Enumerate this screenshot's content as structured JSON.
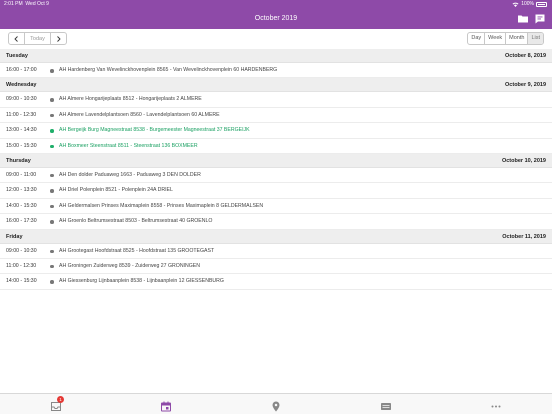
{
  "status_bar": {
    "time": "2:01 PM",
    "date": "Wed Oct 9",
    "battery": "100%"
  },
  "header": {
    "title": "October 2019"
  },
  "toolbar": {
    "today_label": "Today",
    "views": [
      {
        "label": "Day",
        "active": false
      },
      {
        "label": "Week",
        "active": false
      },
      {
        "label": "Month",
        "active": false
      },
      {
        "label": "List",
        "active": true
      }
    ]
  },
  "days": [
    {
      "day_name": "Tuesday",
      "date": "October 8, 2019",
      "events": [
        {
          "time": "16:00 - 17:00",
          "description": "AH Hardenberg Van Wevelinckhovenplein 8565 - Van Wevelinckhovenplein 60 HARDENBERG",
          "highlight": false
        }
      ]
    },
    {
      "day_name": "Wednesday",
      "date": "October 9, 2019",
      "events": [
        {
          "time": "09:00 - 10:30",
          "description": "AH Almere Hongarijeplaats 8512 - Hongarijeplaats 2 ALMERE",
          "highlight": false
        },
        {
          "time": "11:00 - 12:30",
          "description": "AH Almere Lavendelplantsoen 8560 - Lavendelplantsoen 60 ALMERE",
          "highlight": false
        },
        {
          "time": "13:00 - 14:30",
          "description": "AH Bergeijk Burg Magneestraat 8538 - Burgemeester Magneestraat 37 BERGEIJK",
          "highlight": true
        },
        {
          "time": "15:00 - 15:30",
          "description": "AH Boxmeer Steenstraat 8511 - Steenstraat 136 BOXMEER",
          "highlight": true
        }
      ]
    },
    {
      "day_name": "Thursday",
      "date": "October 10, 2019",
      "events": [
        {
          "time": "09:00 - 11:00",
          "description": "AH Den dolder Paduaweg 1663 - Paduaweg 3 DEN DOLDER",
          "highlight": false
        },
        {
          "time": "12:00 - 13:30",
          "description": "AH Driel Polenplein 8521 - Polenplein 24A DRIEL",
          "highlight": false
        },
        {
          "time": "14:00 - 15:30",
          "description": "AH Geldermalsen Prinses Maximaplein 8558 - Prinses Maximaplein 8 GELDERMALSEN",
          "highlight": false
        },
        {
          "time": "16:00 - 17:30",
          "description": "AH Groenlo Beltrumsestraat 8503 - Beltrumsestraat 40 GROENLO",
          "highlight": false
        }
      ]
    },
    {
      "day_name": "Friday",
      "date": "October 11, 2019",
      "events": [
        {
          "time": "09:00 - 10:30",
          "description": "AH Grootegast Hoofdstraat 8525 - Hoofdstraat 135 GROOTEGAST",
          "highlight": false
        },
        {
          "time": "11:00 - 12:30",
          "description": "AH Groningen Zuiderweg 8539 - Zuiderweg 27 GRONINGEN",
          "highlight": false
        },
        {
          "time": "14:00 - 15:30",
          "description": "AH Giessenburg Lijnbaanplein 8538 - Lijnbaanplein 12 GIESSENBURG",
          "highlight": false
        }
      ]
    }
  ],
  "tab_bar": {
    "inbox_badge": "1",
    "tabs": [
      {
        "icon": "inbox-icon",
        "active": false
      },
      {
        "icon": "calendar-icon",
        "active": true
      },
      {
        "icon": "location-pin-icon",
        "active": false
      },
      {
        "icon": "card-icon",
        "active": false
      },
      {
        "icon": "more-icon",
        "active": false
      }
    ]
  },
  "colors": {
    "accent": "#8e4aa8",
    "highlight": "#1aa062"
  }
}
